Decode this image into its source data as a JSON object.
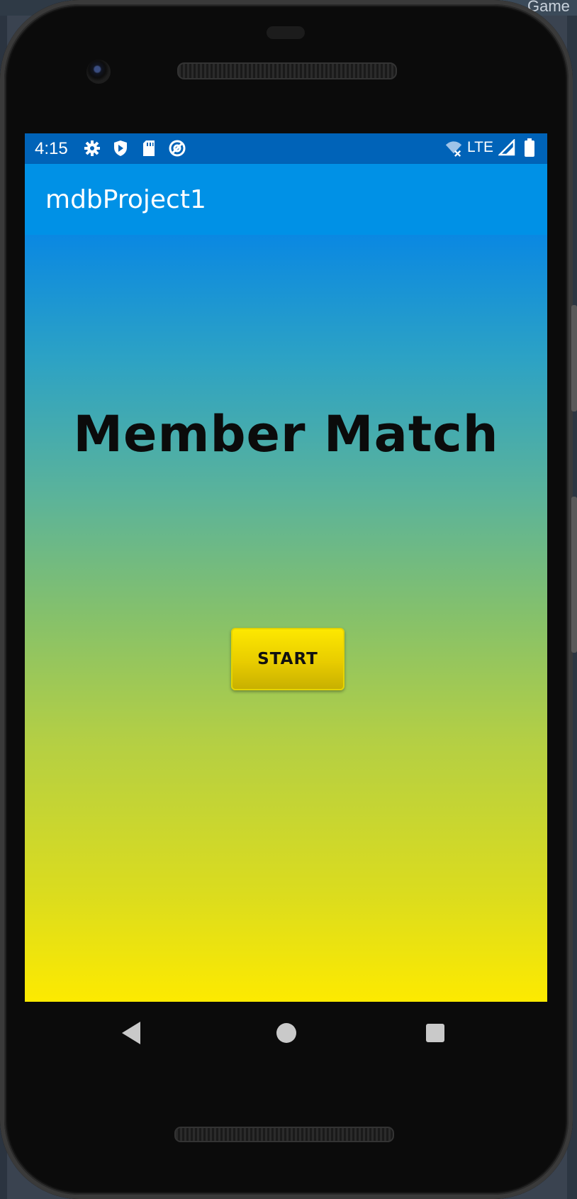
{
  "background": {
    "window_label": "Game"
  },
  "status_bar": {
    "time": "4:15",
    "icons_left": [
      "gear-icon",
      "shield-play-icon",
      "sd-card-icon",
      "at-sign-icon"
    ],
    "network": "LTE",
    "icons_right": [
      "wifi-off-icon",
      "signal-icon",
      "battery-icon"
    ]
  },
  "app_bar": {
    "title": "mdbProject1"
  },
  "main": {
    "title": "Member Match",
    "start_button": "START"
  },
  "nav_bar": {
    "buttons": [
      "back",
      "home",
      "recents"
    ]
  },
  "colors": {
    "status_bar": "#0063b8",
    "app_bar": "#0091e6",
    "gradient_top": "#0a88e2",
    "gradient_bottom": "#fdea00",
    "button": "#fde800"
  }
}
